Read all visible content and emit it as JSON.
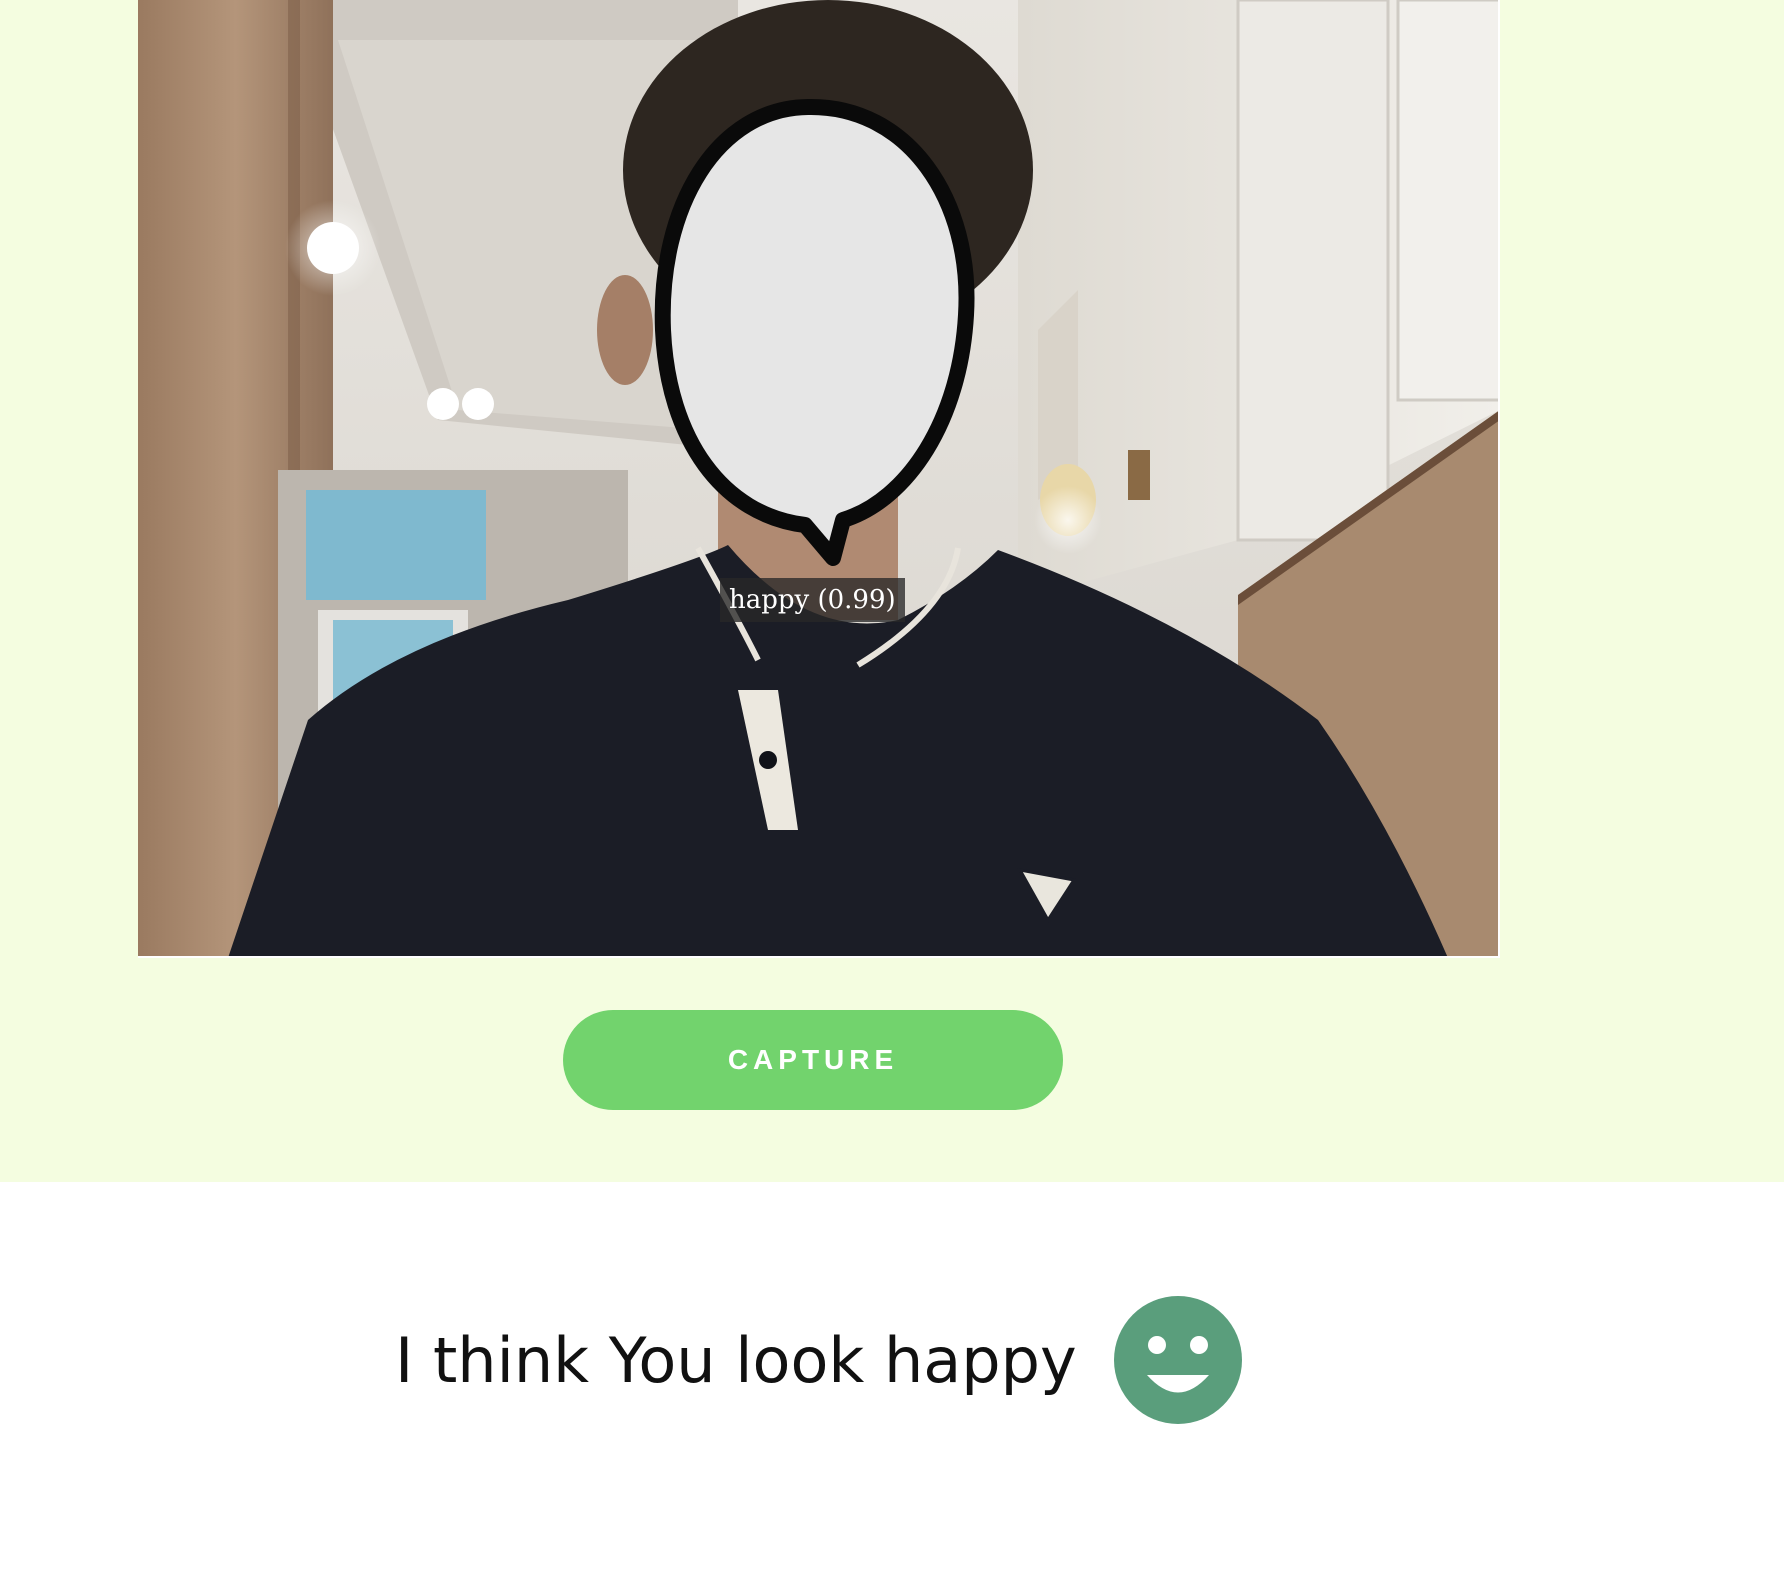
{
  "camera": {
    "detection_label": "happy (0.99)",
    "detected_emotion": "happy",
    "confidence": 0.99
  },
  "controls": {
    "capture_label": "CAPTURE",
    "capture_color": "#72d36d"
  },
  "result": {
    "text": "I think You look happy",
    "icon": "smiley-face-icon",
    "icon_color": "#5a9e7c"
  },
  "colors": {
    "top_background": "#f4fde0",
    "bottom_background": "#ffffff"
  }
}
